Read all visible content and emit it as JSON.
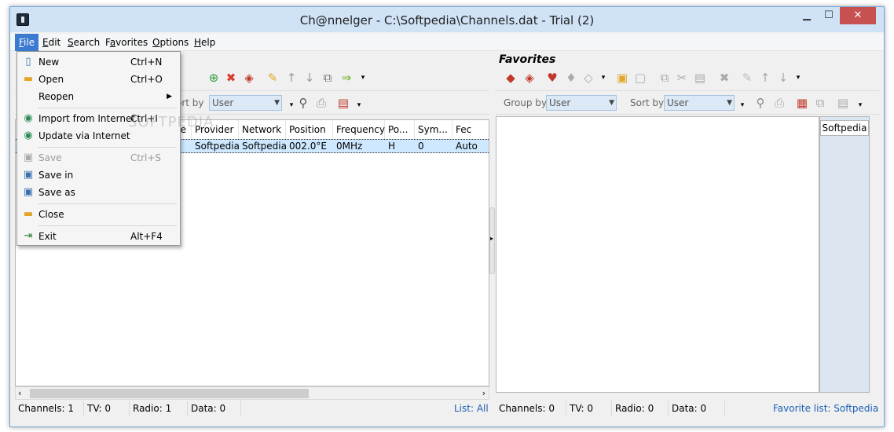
{
  "window": {
    "title": "Ch@nnelger - C:\\Softpedia\\Channels.dat - Trial (2)"
  },
  "menubar": {
    "items": [
      {
        "label": "File",
        "accel": "F",
        "rest": "ile"
      },
      {
        "label": "Edit",
        "accel": "E",
        "rest": "dit"
      },
      {
        "label": "Search",
        "accel": "S",
        "rest": "earch"
      },
      {
        "label": "Favorites",
        "accel": "a",
        "pre": "F",
        "rest": "vorites"
      },
      {
        "label": "Options",
        "accel": "O",
        "rest": "ptions"
      },
      {
        "label": "Help",
        "accel": "H",
        "rest": "elp"
      }
    ]
  },
  "file_menu": {
    "items": [
      {
        "label": "New",
        "shortcut": "Ctrl+N",
        "icon": "new-file-icon",
        "enabled": true
      },
      {
        "label": "Open",
        "shortcut": "Ctrl+O",
        "icon": "open-folder-icon",
        "enabled": true
      },
      {
        "label": "Reopen",
        "shortcut": "",
        "icon": "",
        "enabled": true,
        "submenu": true
      },
      {
        "label": "Import from Internet",
        "shortcut": "Ctrl+I",
        "icon": "globe-import-icon",
        "enabled": true
      },
      {
        "label": "Update via Internet",
        "shortcut": "",
        "icon": "globe-update-icon",
        "enabled": true
      },
      {
        "label": "Save",
        "shortcut": "Ctrl+S",
        "icon": "save-icon",
        "enabled": false
      },
      {
        "label": "Save in",
        "shortcut": "",
        "icon": "save-in-icon",
        "enabled": true
      },
      {
        "label": "Save as",
        "shortcut": "",
        "icon": "save-as-icon",
        "enabled": true
      },
      {
        "label": "Close",
        "shortcut": "",
        "icon": "close-folder-icon",
        "enabled": true
      },
      {
        "label": "Exit",
        "shortcut": "Alt+F4",
        "icon": "exit-icon",
        "enabled": true
      }
    ]
  },
  "left": {
    "sort_label": "ort by",
    "sort_value": "User",
    "columns": [
      "pe",
      "Provider",
      "Network",
      "Position",
      "Frequency",
      "Po...",
      "Sym...",
      "Fec"
    ],
    "row": [
      "",
      "Softpedia",
      "Softpedia",
      "002.0°E",
      "0MHz",
      "H",
      "0",
      "Auto"
    ],
    "status": {
      "channels": "Channels: 1",
      "tv": "TV: 0",
      "radio": "Radio: 1",
      "data": "Data: 0",
      "list": "List: All"
    }
  },
  "right": {
    "title": "Favorites",
    "group_label": "Group by",
    "group_value": "User",
    "sort_label": "Sort by",
    "sort_value": "User",
    "tab": "Softpedia",
    "status": {
      "channels": "Channels: 0",
      "tv": "TV: 0",
      "radio": "Radio: 0",
      "data": "Data: 0",
      "list": "Favorite list: Softpedia"
    }
  },
  "watermark": "SOFTPEDIA",
  "colors": {
    "menu_highlight": "#3a7ad0",
    "selection": "#cde8ff",
    "link": "#1c5fb5",
    "close_button": "#c75050"
  }
}
